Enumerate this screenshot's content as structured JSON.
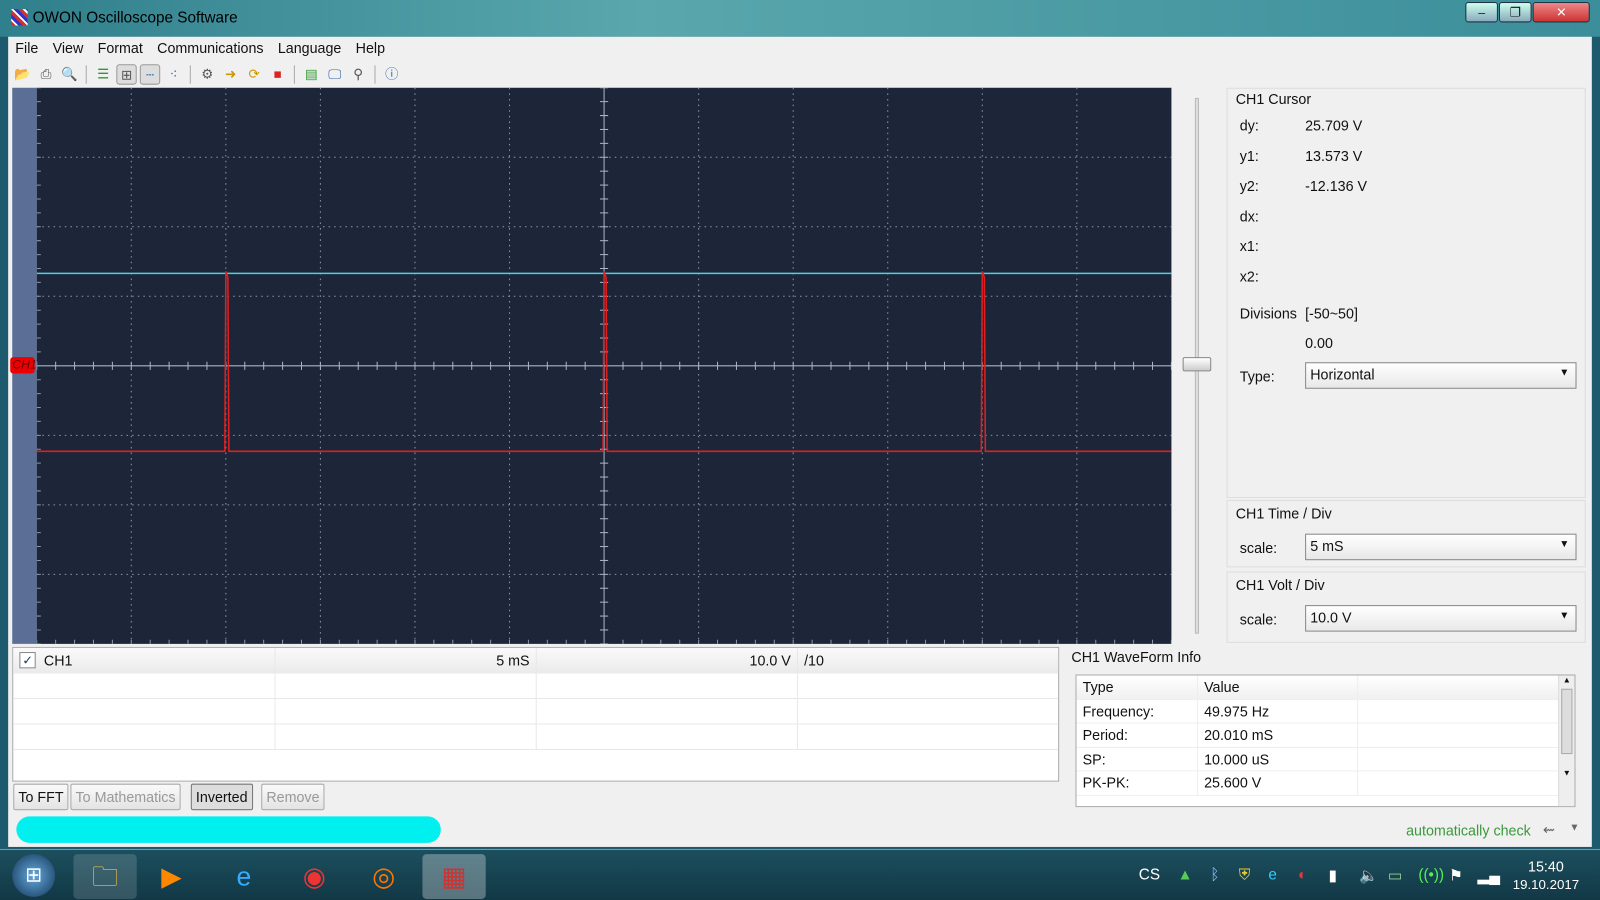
{
  "window": {
    "title": "OWON Oscilloscope Software",
    "minimize": "‒",
    "maximize": "❐",
    "close": "✕"
  },
  "menu": [
    "File",
    "View",
    "Format",
    "Communications",
    "Language",
    "Help"
  ],
  "toolbar": [
    "open-icon",
    "print-icon",
    "print-preview-icon",
    "list-icon",
    "grid-icon",
    "dots-line-icon",
    "dots-icon",
    "settings-icon",
    "import-icon",
    "refresh-icon",
    "stop-icon",
    "film-export-icon",
    "monitor-icon",
    "device-icon",
    "help-icon"
  ],
  "scope": {
    "channel_marker": "CH1",
    "trace_color": "#e02020",
    "cursor_color": "#4fd0e0",
    "cursor_level_div": 1.33,
    "baseline_div": -1.23,
    "pulse_positions_div": [
      -4,
      0,
      4
    ]
  },
  "cursor": {
    "title": "CH1 Cursor",
    "rows": [
      {
        "label": "dy:",
        "value": "25.709 V"
      },
      {
        "label": "y1:",
        "value": "13.573 V"
      },
      {
        "label": "y2:",
        "value": "-12.136 V"
      },
      {
        "label": "dx:",
        "value": ""
      },
      {
        "label": "x1:",
        "value": ""
      },
      {
        "label": "x2:",
        "value": ""
      }
    ],
    "divisions_label": "Divisions",
    "divisions_range": "[-50~50]",
    "divisions_value": "0.00",
    "type_label": "Type:",
    "type_value": "Horizontal"
  },
  "time_div": {
    "title": "CH1 Time / Div",
    "label": "scale:",
    "value": "5  mS"
  },
  "volt_div": {
    "title": "CH1 Volt / Div",
    "label": "scale:",
    "value": "10.0 V"
  },
  "channels": {
    "name": "CH1",
    "checked": true,
    "time": "5  mS",
    "volt": "10.0 V",
    "probe": "/10"
  },
  "buttons": {
    "fft": "To FFT",
    "math": "To Mathematics",
    "inverted": "Inverted",
    "remove": "Remove"
  },
  "waveinfo": {
    "title": "CH1 WaveForm Info",
    "headers": [
      "Type",
      "Value"
    ],
    "rows": [
      {
        "type": "Frequency:",
        "value": "49.975 Hz"
      },
      {
        "type": "Period:",
        "value": "20.010 mS"
      },
      {
        "type": "SP:",
        "value": "10.000 uS"
      },
      {
        "type": "PK-PK:",
        "value": "25.600 V"
      }
    ]
  },
  "status": {
    "text": "automatically check"
  },
  "taskbar": {
    "lang": "CS",
    "time": "15:40",
    "date": "19.10.2017"
  }
}
